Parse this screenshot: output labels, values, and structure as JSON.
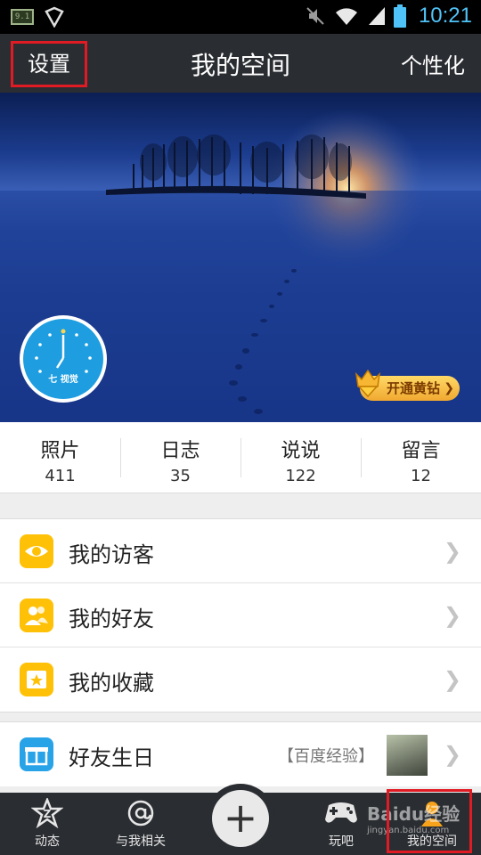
{
  "status_bar": {
    "sim_label": "9.1",
    "time": "10:21",
    "icons": [
      "sim-card-icon",
      "shield-icon",
      "mute-icon",
      "wifi-icon",
      "signal-icon",
      "battery-icon"
    ]
  },
  "header": {
    "left_button": "设置",
    "title": "我的空间",
    "right_button": "个性化"
  },
  "cover": {
    "avatar_text": "七 视觉",
    "vip_label": "开通黄钻"
  },
  "stats": [
    {
      "label": "照片",
      "value": "411"
    },
    {
      "label": "日志",
      "value": "35"
    },
    {
      "label": "说说",
      "value": "122"
    },
    {
      "label": "留言",
      "value": "12"
    }
  ],
  "menu": {
    "group1": [
      {
        "label": "我的访客",
        "icon": "eye-icon"
      },
      {
        "label": "我的好友",
        "icon": "friends-icon"
      },
      {
        "label": "我的收藏",
        "icon": "star-folder-icon"
      }
    ],
    "group2": [
      {
        "label": "好友生日",
        "icon": "gift-icon",
        "extra": "【百度经验】"
      }
    ]
  },
  "bottom_nav": {
    "items": [
      {
        "label": "动态",
        "icon": "star-z-icon"
      },
      {
        "label": "与我相关",
        "icon": "at-icon"
      },
      {
        "label": "玩吧",
        "icon": "gamepad-icon"
      },
      {
        "label": "我的空间",
        "icon": "person-icon"
      }
    ],
    "center_label": "+"
  },
  "watermark": {
    "text": "Baidu经验",
    "url": "jingyan.baidu.com"
  },
  "colors": {
    "top_bar": "#2a2d31",
    "accent_yellow": "#ffc107",
    "accent_blue": "#29a3e8",
    "highlight_red": "#e01b24",
    "clock_blue": "#4fc3f7"
  }
}
